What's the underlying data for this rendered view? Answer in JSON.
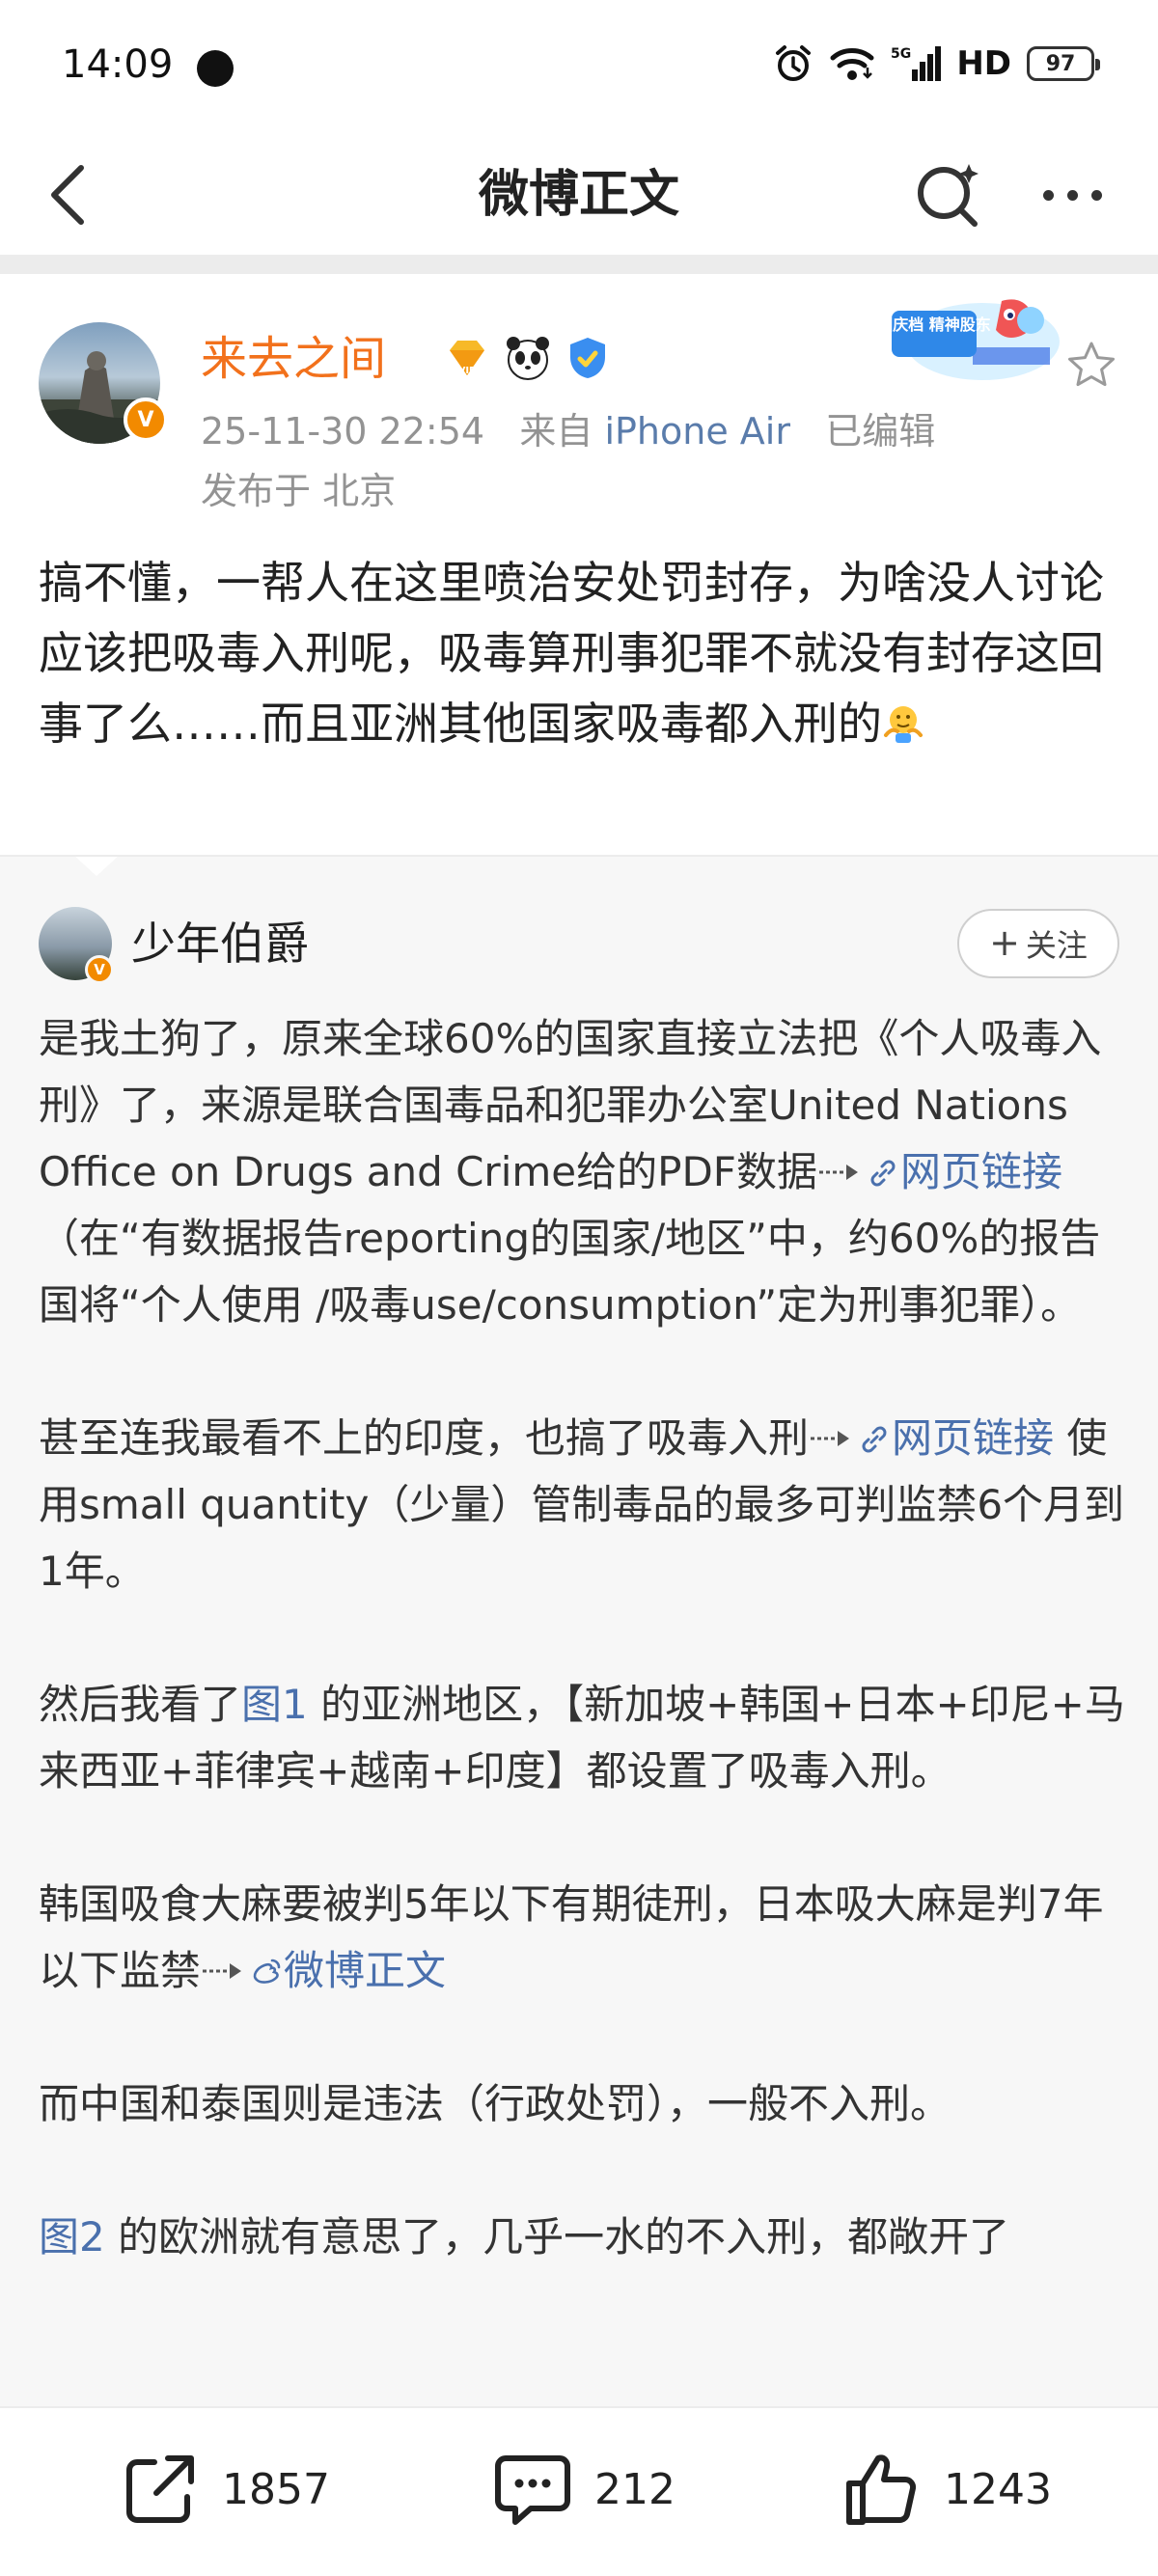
{
  "status_bar": {
    "time": "14:09",
    "network": "5G",
    "hd": "HD",
    "battery": "97"
  },
  "nav": {
    "title": "微博正文"
  },
  "post": {
    "author": "来去之间",
    "avatar_badge": "V",
    "timestamp": "25-11-30 22:54",
    "source_prefix": "来自",
    "source": "iPhone Air",
    "edited": "已编辑",
    "location": "发布于 北京",
    "text": "搞不懂，一帮人在这里喷治安处罚封存，为啥没人讨论应该把吸毒入刑呢，吸毒算刑事犯罪不就没有封存这回事了么……而且亚洲其他国家吸毒都入刑的",
    "sticker_label": "国庆档 精神股东"
  },
  "comment": {
    "author": "少年伯爵",
    "follow_plus": "+",
    "follow_label": "关注",
    "p1_a": "是我土狗了，原来全球60%的国家直接立法把《个人吸毒入刑》了，来源是联合国毒品和犯罪办公室United Nations Office on Drugs and Crime给的PDF数据",
    "p1_link": "网页链接",
    "p1_b": " （在“有数据报告reporting的国家/地区”中，约60%的报告国将“个人使用 /吸毒use/consumption”定为刑事犯罪）。",
    "p2_a": "甚至连我最看不上的印度，也搞了吸毒入刑",
    "p2_link": "网页链接",
    "p2_b": " 使用small quantity（少量）管制毒品的最多可判监禁6个月到1年。",
    "p3_a": "然后我看了",
    "p3_link": "图1",
    "p3_b": " 的亚洲地区，【新加坡+韩国+日本+印尼+马来西亚+菲律宾+越南+印度】都设置了吸毒入刑。",
    "p4_a": "韩国吸食大麻要被判5年以下有期徒刑，日本吸大麻是判7年以下监禁",
    "p4_link": "微博正文",
    "p5": "而中国和泰国则是违法（行政处罚），一般不入刑。",
    "p6_link": "图2",
    "p6_b": " 的欧洲就有意思了，几乎一水的不入刑，都敞开了"
  },
  "actions": {
    "shares": "1857",
    "comments": "212",
    "likes": "1243"
  },
  "colors": {
    "author_orange": "#f2711c",
    "link_blue": "#4a70ad",
    "meta_gray": "#939393",
    "comment_bg": "#f7f7f7"
  },
  "icons": [
    "back-arrow-icon",
    "search-icon",
    "more-icon",
    "star-icon",
    "vip-badge-icon",
    "panda-badge-icon",
    "blue-verified-icon",
    "share-icon",
    "comment-icon",
    "like-icon",
    "link-icon",
    "weibo-icon"
  ]
}
